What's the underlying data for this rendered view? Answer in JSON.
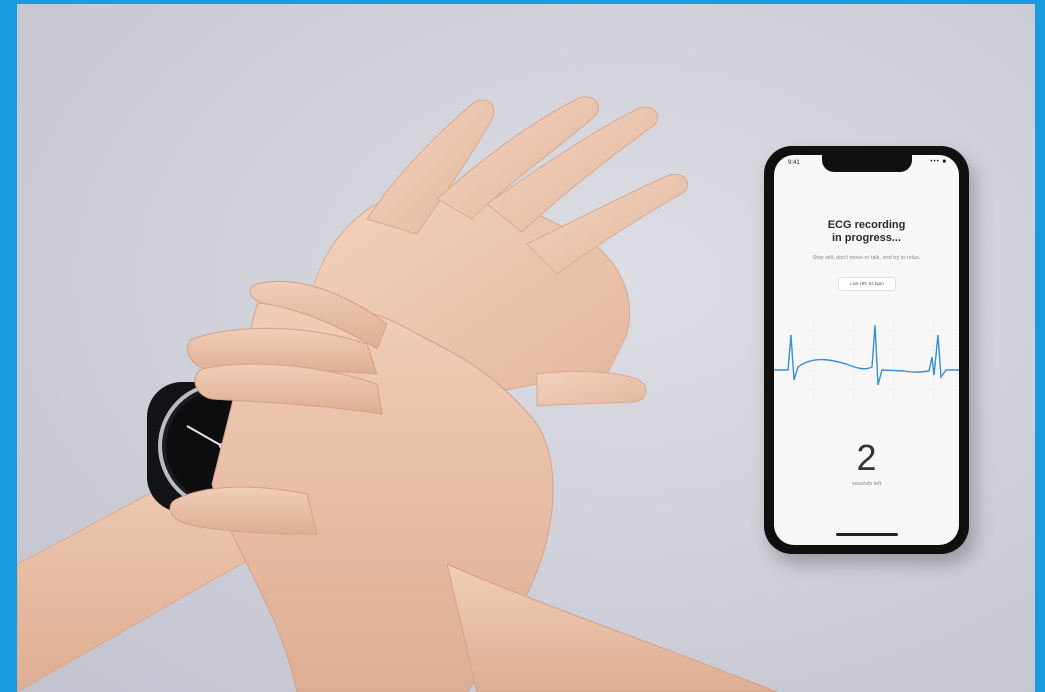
{
  "phone": {
    "status_time": "9:41",
    "status_icons": "••• ■",
    "title_line1": "ECG recording",
    "title_line2": "in progress...",
    "instructions": "Stay still, don't move or talk, and try to relax.",
    "live_hr": "Live HR: 64 bpm",
    "countdown_value": "2",
    "countdown_label": "seconds left"
  },
  "colors": {
    "frame": "#1a9be0",
    "ecg_trace": "#3a8fd0",
    "watch_hand_accent": "#f2c300"
  }
}
